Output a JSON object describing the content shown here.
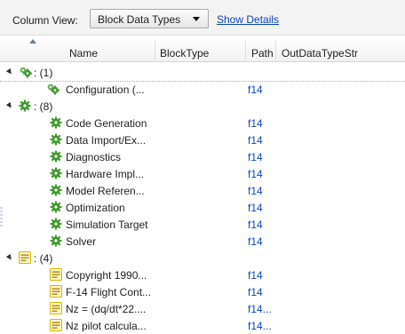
{
  "toolbar": {
    "column_view_label": "Column View:",
    "column_view_value": "Block Data Types",
    "show_details_label": "Show Details"
  },
  "columns": [
    "Name",
    "BlockType",
    "Path",
    "OutDataTypeStr"
  ],
  "groups": [
    {
      "label": ": (1)",
      "icon": "configuration-set-icon",
      "items": [
        {
          "name": "Configuration (...",
          "path": "f14"
        }
      ]
    },
    {
      "label": ": (8)",
      "icon": "gear-icon",
      "items": [
        {
          "name": "Code Generation",
          "path": "f14"
        },
        {
          "name": "Data Import/Ex...",
          "path": "f14"
        },
        {
          "name": "Diagnostics",
          "path": "f14"
        },
        {
          "name": "Hardware Impl...",
          "path": "f14"
        },
        {
          "name": "Model Referen...",
          "path": "f14"
        },
        {
          "name": "Optimization",
          "path": "f14"
        },
        {
          "name": "Simulation Target",
          "path": "f14"
        },
        {
          "name": "Solver",
          "path": "f14"
        }
      ]
    },
    {
      "label": ": (4)",
      "icon": "annotation-icon",
      "items": [
        {
          "name": "Copyright 1990...",
          "path": "f14"
        },
        {
          "name": "F-14 Flight Cont...",
          "path": "f14"
        },
        {
          "name": "Nz = (dq/dt*22....",
          "path": "f14..."
        },
        {
          "name": "Nz pilot calcula...",
          "path": "f14..."
        }
      ]
    }
  ],
  "colors": {
    "link": "#0b44b8",
    "gear": "#3f9a2e",
    "annotation": "#d9b600"
  }
}
